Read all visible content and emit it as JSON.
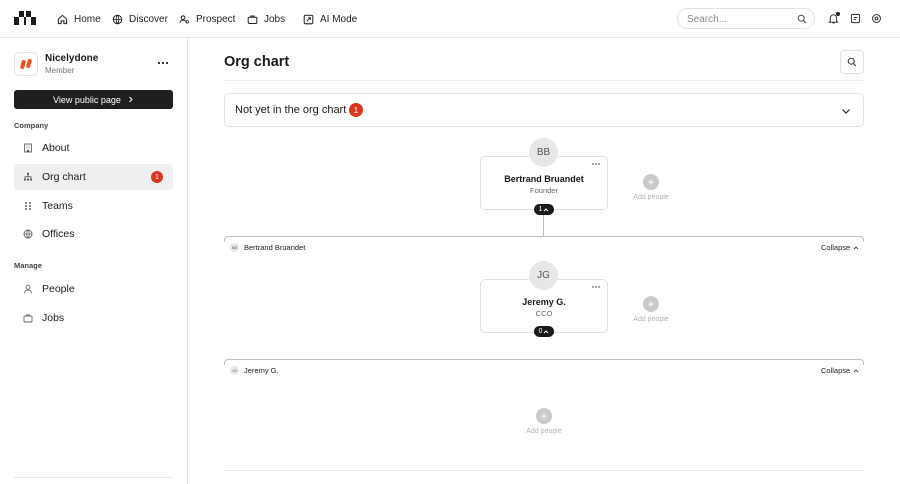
{
  "nav": {
    "items": [
      {
        "label": "Home",
        "icon": "home-icon"
      },
      {
        "label": "Discover",
        "icon": "globe-icon"
      },
      {
        "label": "Prospect",
        "icon": "prospect-icon"
      },
      {
        "label": "Jobs",
        "icon": "briefcase-icon"
      },
      {
        "label": "AI Mode",
        "icon": "ai-mode-icon"
      }
    ],
    "search_placeholder": "Search..."
  },
  "sidebar": {
    "company_name": "Nicelydone",
    "company_role": "Member",
    "public_button": "View public page",
    "company_section": "Company",
    "company_items": [
      {
        "label": "About",
        "icon": "building-icon"
      },
      {
        "label": "Org chart",
        "icon": "org-chart-icon",
        "badge": "1",
        "active": true
      },
      {
        "label": "Teams",
        "icon": "teams-icon"
      },
      {
        "label": "Offices",
        "icon": "globe-icon"
      }
    ],
    "manage_section": "Manage",
    "manage_items": [
      {
        "label": "People",
        "icon": "people-icon"
      },
      {
        "label": "Jobs",
        "icon": "briefcase-icon"
      }
    ]
  },
  "main": {
    "title": "Org chart",
    "not_yet_label": "Not yet in the org chart",
    "not_yet_count": "1",
    "nodes": [
      {
        "initials": "BB",
        "name": "Bertrand Bruandet",
        "role": "Founder",
        "count": "1",
        "group_label": "Bertrand Bruandet"
      },
      {
        "initials": "JG",
        "name": "Jeremy G.",
        "role": "CCO",
        "count": "0",
        "group_label": "Jeremy G."
      }
    ],
    "add_people": "Add people",
    "collapse": "Collapse"
  },
  "colors": {
    "badge": "#d9361e",
    "dark": "#1f1f1f",
    "accent_logo": "#f0501e"
  }
}
